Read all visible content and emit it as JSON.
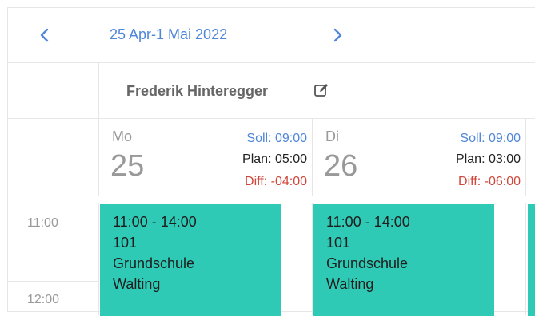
{
  "navigation": {
    "date_range": "25 Apr-1 Mai 2022",
    "prev_icon": "chevron-left-icon",
    "next_icon": "chevron-right-icon"
  },
  "resource": {
    "name": "Frederik Hinteregger",
    "edit_icon": "edit-icon"
  },
  "days": [
    {
      "name": "Mo",
      "number": "25",
      "soll": "Soll: 09:00",
      "plan": "Plan: 05:00",
      "diff": "Diff: -04:00"
    },
    {
      "name": "Di",
      "number": "26",
      "soll": "Soll: 09:00",
      "plan": "Plan: 03:00",
      "diff": "Diff: -06:00"
    }
  ],
  "time_slots": [
    "11:00",
    "12:00"
  ],
  "events": [
    {
      "time": "11:00 - 14:00",
      "code": "101",
      "line1": "Grundschule",
      "line2": "Walting"
    },
    {
      "time": "11:00 - 14:00",
      "code": "101",
      "line1": "Grundschule",
      "line2": "Walting"
    }
  ],
  "colors": {
    "accent_blue": "#4f87d9",
    "event_teal": "#2fcab5",
    "diff_red": "#d0463a"
  }
}
